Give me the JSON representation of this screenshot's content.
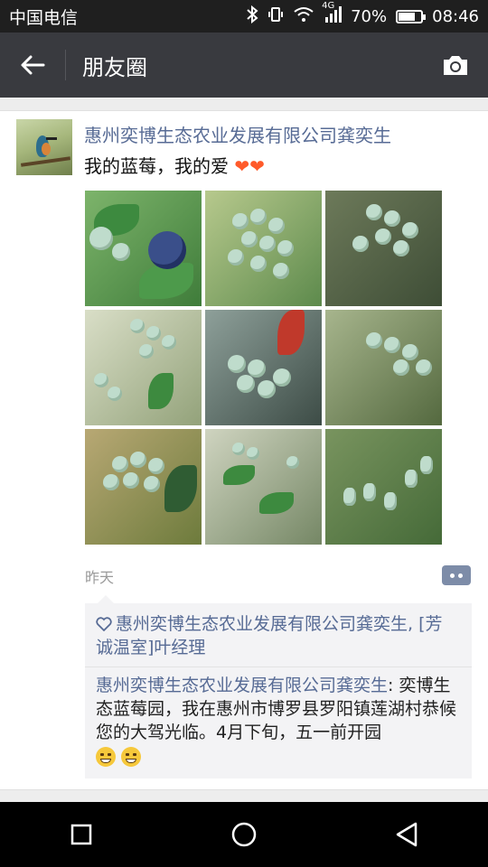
{
  "status_bar": {
    "carrier": "中国电信",
    "network": "4G",
    "battery": "70%",
    "battery_level": 0.7,
    "time": "08:46",
    "icons": [
      "bluetooth-icon",
      "vibrate-icon",
      "wifi-icon",
      "signal-icon",
      "battery-icon"
    ]
  },
  "title_bar": {
    "title": "朋友圈",
    "icons": [
      "back-arrow-icon",
      "camera-icon"
    ]
  },
  "post": {
    "author": "惠州奕博生态农业发展有限公司龚奕生",
    "text": "我的蓝莓，我的爱",
    "text_hearts": "❤❤",
    "photos_count": 9,
    "timestamp": "昨天",
    "likes_icon": "heart-outline-icon",
    "likes": "惠州奕博生态农业发展有限公司龚奕生, [芳诚温室]叶经理",
    "comment_author": "惠州奕博生态农业发展有限公司龚奕生",
    "comment_sep": ": ",
    "comment_text": "奕博生态蓝莓园，我在惠州市博罗县罗阳镇莲湖村恭候您的大驾光临。4月下旬，五一前开园"
  },
  "colors": {
    "titlebar": "#393a3f",
    "link": "#576b95",
    "background": "#ededed"
  }
}
